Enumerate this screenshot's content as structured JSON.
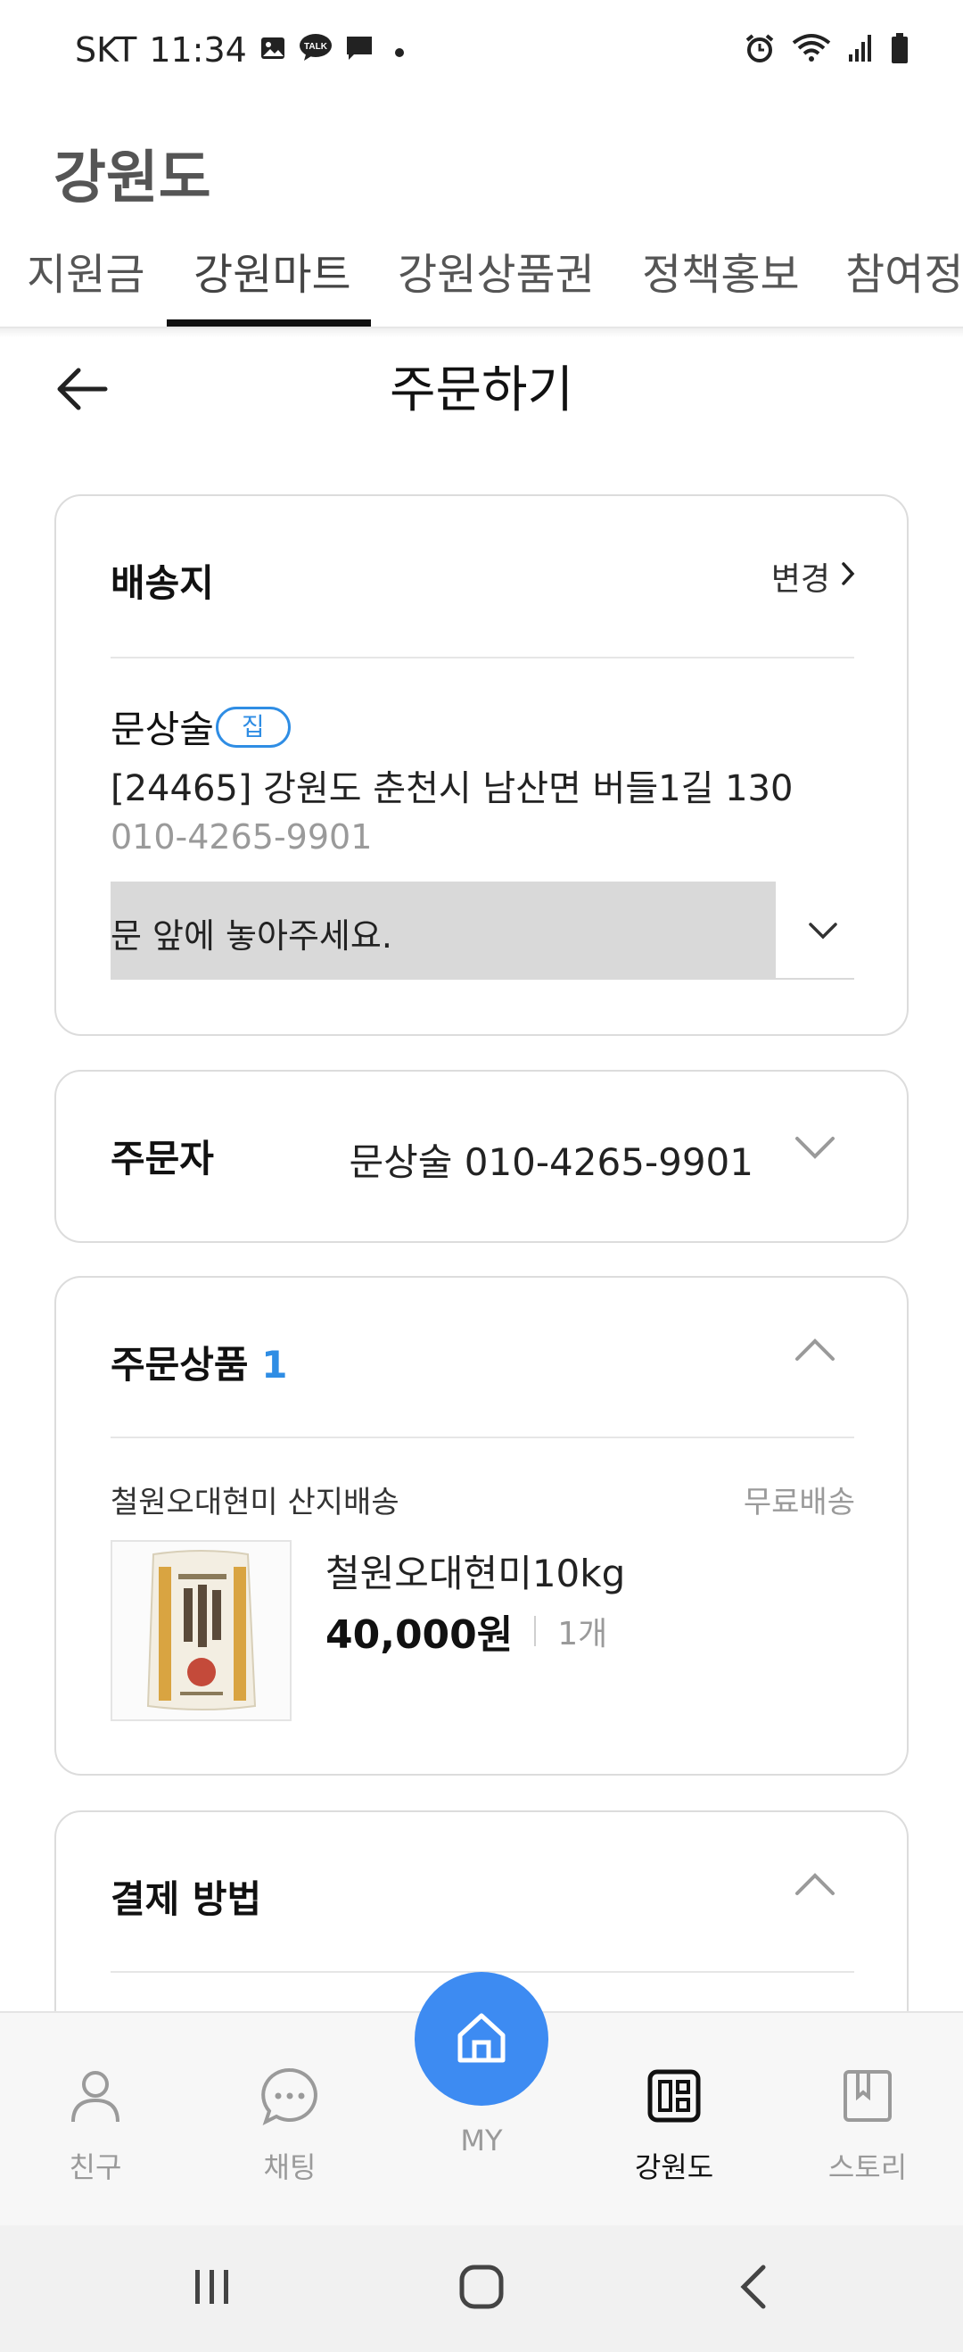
{
  "status_bar": {
    "carrier": "SKT",
    "time": "11:34",
    "left_icons": [
      "gallery-icon",
      "talk-icon",
      "message-icon",
      "dot-icon"
    ],
    "right_icons": [
      "alarm-icon",
      "wifi-icon",
      "signal-icon",
      "battery-icon"
    ],
    "talk_badge": "TALK"
  },
  "app": {
    "title": "강원도",
    "tabs": [
      {
        "label": "지원금",
        "active": false
      },
      {
        "label": "강원마트",
        "active": true
      },
      {
        "label": "강원상품권",
        "active": false
      },
      {
        "label": "정책홍보",
        "active": false
      },
      {
        "label": "참여정책",
        "active": false
      }
    ]
  },
  "page": {
    "title": "주문하기",
    "back_icon": "arrow-left-icon"
  },
  "delivery": {
    "heading": "배송지",
    "change_label": "변경",
    "recipient_name": "문상술",
    "badge": "집",
    "address": "[24465] 강원도 춘천시 남산면 버들1길 130",
    "phone": "010-4265-9901",
    "memo": "문 앞에 놓아주세요."
  },
  "orderer": {
    "heading": "주문자",
    "value": "문상술 010-4265-9901"
  },
  "order_items": {
    "heading": "주문상품",
    "count": "1",
    "seller": "철원오대현미 산지배송",
    "shipping": "무료배송",
    "product_name": "철원오대현미10kg",
    "price": "40,000원",
    "quantity": "1개"
  },
  "payment": {
    "heading": "결제 방법"
  },
  "bottom_nav": {
    "items": [
      {
        "label": "친구",
        "icon": "person-icon",
        "active": false
      },
      {
        "label": "채팅",
        "icon": "chat-bubble-icon",
        "active": false
      },
      {
        "label": "MY",
        "icon": "home-icon",
        "active": false
      },
      {
        "label": "강원도",
        "icon": "grid-icon",
        "active": true
      },
      {
        "label": "스토리",
        "icon": "book-icon",
        "active": false
      }
    ]
  },
  "colors": {
    "accent_blue": "#2f8de4",
    "fab_blue": "#3d8bf2",
    "card_border": "#dcdcdc",
    "memo_bg": "#d9d9d9"
  }
}
